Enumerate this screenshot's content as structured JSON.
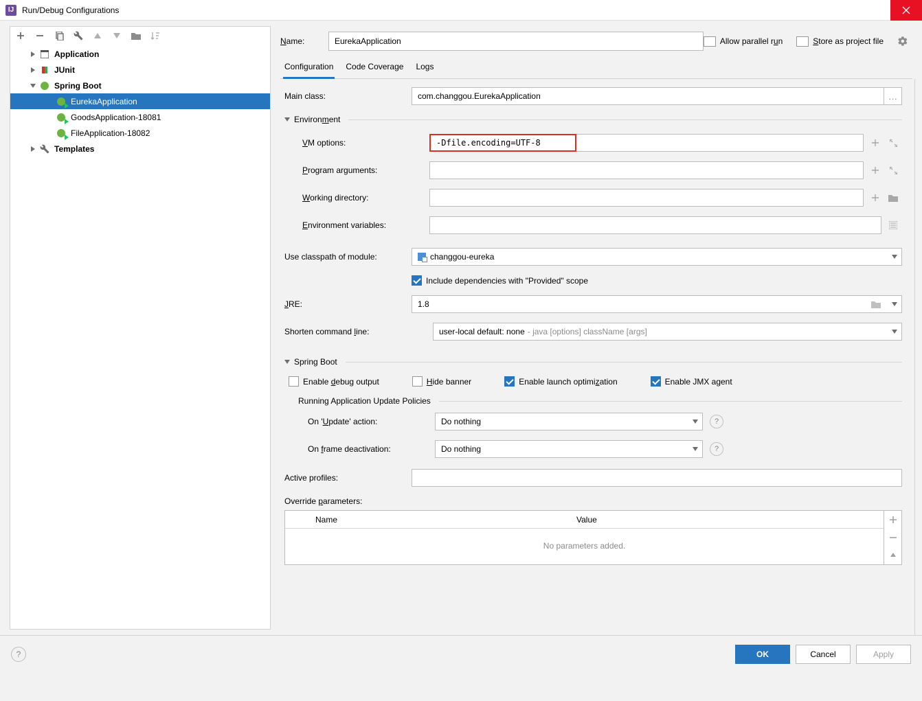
{
  "window_title": "Run/Debug Configurations",
  "tree": {
    "items": [
      {
        "label": "Application",
        "bold": true
      },
      {
        "label": "JUnit",
        "bold": true
      },
      {
        "label": "Spring Boot",
        "bold": true
      },
      {
        "label": "EurekaApplication"
      },
      {
        "label": "GoodsApplication-18081"
      },
      {
        "label": "FileApplication-18082"
      },
      {
        "label": "Templates",
        "bold": true
      }
    ]
  },
  "name_label_pre": "N",
  "name_label_post": "ame:",
  "name_value": "EurekaApplication",
  "allow_parallel_run_pre": "Allow parallel r",
  "allow_parallel_run_mid": "u",
  "allow_parallel_run_post": "n",
  "store_as_pre": "S",
  "store_as_post": "tore as project file",
  "tabs": {
    "config": "Configuration",
    "coverage": "Code Coverage",
    "logs": "Logs"
  },
  "labels": {
    "main_class": "Main class:",
    "environment_pre": "Environ",
    "environment_mid": "m",
    "environment_post": "ent",
    "vm_pre": "V",
    "vm_post": "M options:",
    "pa_pre": "P",
    "pa_post": "rogram arguments:",
    "wd_pre": "W",
    "wd_post": "orking directory:",
    "ev_pre": "E",
    "ev_post": "nvironment variables:",
    "ucm": "Use classpath of module:",
    "provided": "Include dependencies with \"Provided\" scope",
    "jre_pre": "J",
    "jre_post": "RE:",
    "scl_pre": "Shorten command ",
    "scl_mid": "l",
    "scl_post": "ine:",
    "springboot": "Spring Boot",
    "debug_pre": "Enable ",
    "debug_mid": "d",
    "debug_post": "ebug output",
    "hide_pre": "H",
    "hide_post": "ide banner",
    "launch_pre": "Enable launch optimi",
    "launch_mid": "z",
    "launch_post": "ation",
    "jmx": "Enable JMX agent",
    "rup": "Running Application Update Policies",
    "on_update_pre": "On '",
    "on_update_mid": "U",
    "on_update_post": "pdate' action:",
    "on_frame_pre": "On ",
    "on_frame_mid": "f",
    "on_frame_post": "rame deactivation:",
    "active_profiles": "Active profiles:",
    "override_pre": "Override ",
    "override_mid": "p",
    "override_post": "arameters:",
    "col_name": "Name",
    "col_value": "Value",
    "no_params": "No parameters added."
  },
  "values": {
    "main_class": "com.changgou.EurekaApplication",
    "vm_options": "-Dfile.encoding=UTF-8",
    "module": "changgou-eureka",
    "jre": "1.8",
    "scl": "user-local default: none",
    "scl_hint": " - java [options] className [args]",
    "do_nothing1": "Do nothing",
    "do_nothing2": "Do nothing"
  },
  "buttons": {
    "ok": "OK",
    "cancel": "Cancel",
    "apply": "Apply"
  }
}
